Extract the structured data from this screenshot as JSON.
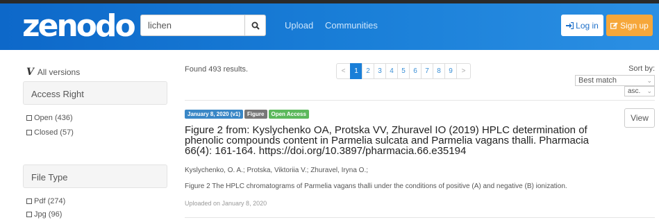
{
  "header": {
    "logo": "zenodo",
    "search_value": "lichen",
    "nav": [
      "Upload",
      "Communities"
    ],
    "login_label": "Log in",
    "signup_label": "Sign up",
    "colors": {
      "header_blue": "#1a7fd8",
      "signup_orange": "#f6a73a"
    },
    "icons": [
      "search-icon",
      "login-icon",
      "edit-icon"
    ]
  },
  "sidebar": {
    "all_versions": "All versions",
    "facets": [
      {
        "title": "Access Right",
        "items": [
          {
            "label": "Open (436)"
          },
          {
            "label": "Closed (57)"
          }
        ]
      },
      {
        "title": "File Type",
        "items": [
          {
            "label": "Pdf (274)"
          },
          {
            "label": "Jpg (96)"
          }
        ]
      }
    ]
  },
  "results": {
    "found": "Found 493 results.",
    "pagination": {
      "prev": "<",
      "next": ">",
      "pages": [
        "1",
        "2",
        "3",
        "4",
        "5",
        "6",
        "7",
        "8",
        "9"
      ],
      "current": "1"
    },
    "sort": {
      "label": "Sort by:",
      "selected": "Best match",
      "order": "asc."
    },
    "items": [
      {
        "badges": {
          "date": "January 8, 2020 (v1)",
          "type": "Figure",
          "access": "Open Access"
        },
        "view_label": "View",
        "title": "Figure 2 from: Kyslychenko OA, Protska VV, Zhuravel IO (2019) HPLC determination of phenolic compounds content in Parmelia sulcata and Parmelia vagans thalli. Pharmacia 66(4): 161-164. https://doi.org/10.3897/pharmacia.66.e35194",
        "authors": "Kyslychenko, O. A.; Protska, Viktoriia V.; Zhuravel, Iryna O.;",
        "description": "Figure 2 The HPLC chromatograms of Parmelia vagans thalli under the conditions of positive (A) and negative (B) ionization.",
        "uploaded": "Uploaded on January 8, 2020"
      }
    ]
  }
}
